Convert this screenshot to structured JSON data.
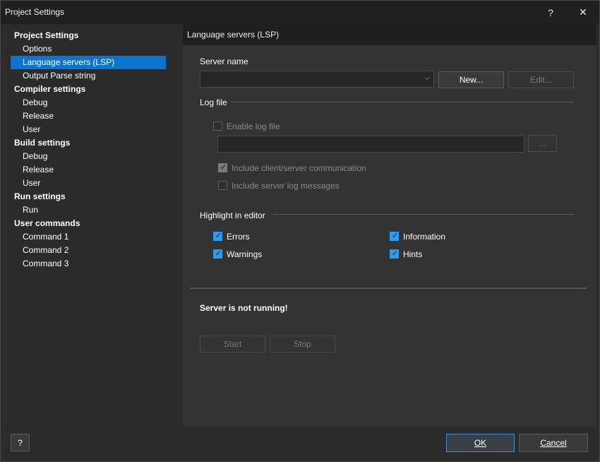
{
  "window": {
    "title": "Project Settings"
  },
  "titlebar": {
    "help_label": "?",
    "close_label": "✕"
  },
  "sidebar": {
    "items": [
      {
        "label": "Project Settings",
        "type": "group"
      },
      {
        "label": "Options",
        "type": "child"
      },
      {
        "label": "Language servers (LSP)",
        "type": "child",
        "selected": true
      },
      {
        "label": "Output Parse string",
        "type": "child"
      },
      {
        "label": "Compiler settings",
        "type": "group"
      },
      {
        "label": "Debug",
        "type": "child"
      },
      {
        "label": "Release",
        "type": "child"
      },
      {
        "label": "User",
        "type": "child"
      },
      {
        "label": "Build settings",
        "type": "group"
      },
      {
        "label": "Debug",
        "type": "child"
      },
      {
        "label": "Release",
        "type": "child"
      },
      {
        "label": "User",
        "type": "child"
      },
      {
        "label": "Run settings",
        "type": "group"
      },
      {
        "label": "Run",
        "type": "child"
      },
      {
        "label": "User commands",
        "type": "group"
      },
      {
        "label": "Command 1",
        "type": "child"
      },
      {
        "label": "Command 2",
        "type": "child"
      },
      {
        "label": "Command 3",
        "type": "child"
      }
    ]
  },
  "content": {
    "header": "Language servers (LSP)",
    "server_name": {
      "label": "Server name",
      "value": "",
      "new_label": "New...",
      "edit_label": "Edit..."
    },
    "log_file": {
      "section": "Log file",
      "enable_label": "Enable log file",
      "enable_checked": false,
      "path_value": "",
      "browse_label": "...",
      "include_comm_label": "Include client/server communication",
      "include_comm_checked": true,
      "include_server_label": "Include server log messages",
      "include_server_checked": false
    },
    "highlight": {
      "section": "Highlight in editor",
      "errors_label": "Errors",
      "warnings_label": "Warnings",
      "information_label": "Information",
      "hints_label": "Hints"
    },
    "status": {
      "text": "Server is not running!",
      "start_label": "Start",
      "stop_label": "Stop"
    }
  },
  "footer": {
    "help_label": "?",
    "ok_label": "OK",
    "cancel_label": "Cancel"
  },
  "colors": {
    "accent": "#0a74d0",
    "checkbox_checked": "#2e9bf0",
    "background": "#2b2b2b",
    "panel": "#333333"
  }
}
